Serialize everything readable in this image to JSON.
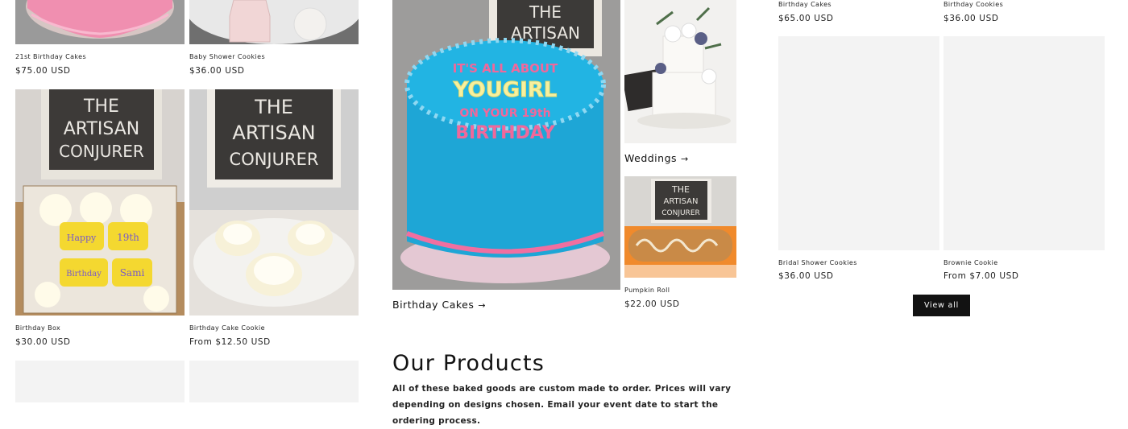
{
  "products_left": [
    {
      "title": "21st Birthday Cakes",
      "price": "$75.00 USD"
    },
    {
      "title": "Baby Shower Cookies",
      "price": "$36.00 USD"
    },
    {
      "title": "Birthday Box",
      "price": "$30.00 USD"
    },
    {
      "title": "Birthday Cake Cookie",
      "price": "From $12.50 USD"
    }
  ],
  "letter_board": {
    "line1": "THE",
    "line2": "ARTISAN",
    "line3": "CONJURER"
  },
  "cookie_text": {
    "happy": "Happy",
    "age": "19th",
    "birthday": "Birthday",
    "name": "Sami"
  },
  "cake_message": {
    "l1": "IT'S ALL ABOUT",
    "l2": "YOUGIRL",
    "l3": "ON YOUR 19th",
    "l4": "BIRTHDAY"
  },
  "collections": [
    {
      "label": "Birthday Cakes",
      "arrow": "→"
    },
    {
      "label": "Weddings",
      "arrow": "→"
    }
  ],
  "featured_product": {
    "title": "Pumpkin Roll",
    "price": "$22.00 USD"
  },
  "products_right": [
    {
      "title": "Birthday Cakes",
      "price": "$65.00 USD"
    },
    {
      "title": "Birthday Cookies",
      "price": "$36.00 USD"
    },
    {
      "title": "Bridal Shower Cookies",
      "price": "$36.00 USD"
    },
    {
      "title": "Brownie Cookie",
      "price": "From $7.00 USD"
    }
  ],
  "view_all_label": "View all",
  "section": {
    "heading": "Our Products",
    "text": "All of these baked goods are custom made to order. Prices will vary depending on designs chosen. Email your event date to start the ordering process."
  },
  "colors": {
    "text": "#121212",
    "button_bg": "#121212",
    "placeholder": "#f3f3f3"
  }
}
